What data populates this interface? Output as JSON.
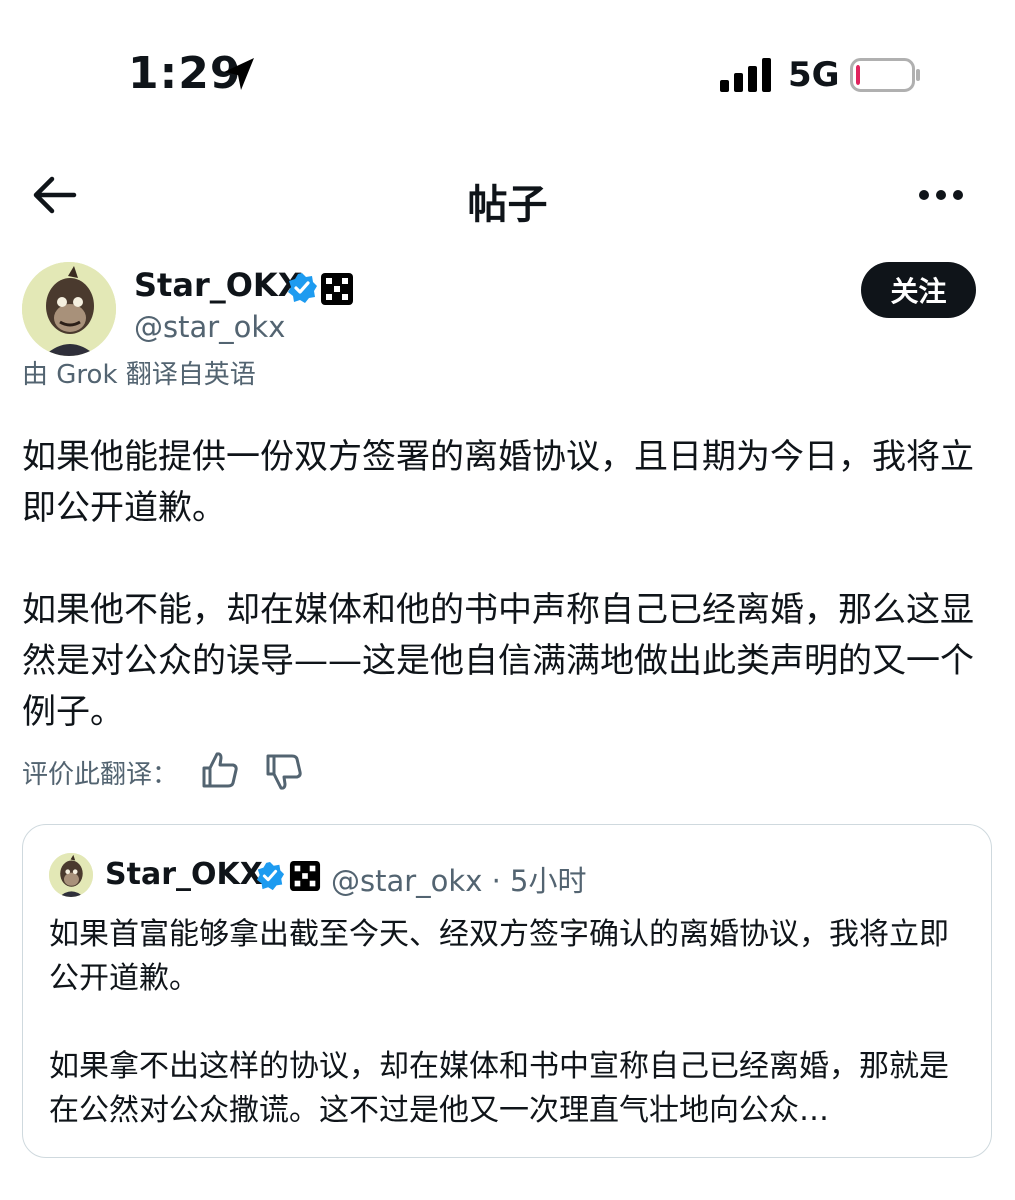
{
  "status_bar": {
    "time": "1:29",
    "network": "5G",
    "battery_level": 0.05,
    "battery_color": "#e0245e"
  },
  "header": {
    "title": "帖子"
  },
  "author": {
    "display_name": "Star_OKX",
    "handle": "@star_okx",
    "verified_color": "#1d9bf0"
  },
  "follow_label": "关注",
  "translated_by": "由 Grok 翻译自英语",
  "post": {
    "paragraphs": [
      "如果他能提供一份双方签署的离婚协议，且日期为今日，我将立即公开道歉。",
      "如果他不能，却在媒体和他的书中声称自己已经离婚，那么这显然是对公众的误导——这是他自信满满地做出此类声明的又一个例子。"
    ]
  },
  "rate": {
    "label": "评价此翻译："
  },
  "quote": {
    "display_name": "Star_OKX",
    "handle_time": "@star_okx · 5小时",
    "paragraphs": [
      "如果首富能够拿出截至今天、经双方签字确认的离婚协议，我将立即公开道歉。",
      "如果拿不出这样的协议，却在媒体和书中宣称自己已经离婚，那就是在公然对公众撒谎。这不过是他又一次理直气壮地向公众…"
    ]
  },
  "icons": [
    "location-arrow-icon",
    "signal-icon",
    "battery-icon",
    "back-arrow-icon",
    "more-icon",
    "verified-icon",
    "affiliate-badge-icon",
    "thumb-up-icon",
    "thumb-down-icon"
  ]
}
